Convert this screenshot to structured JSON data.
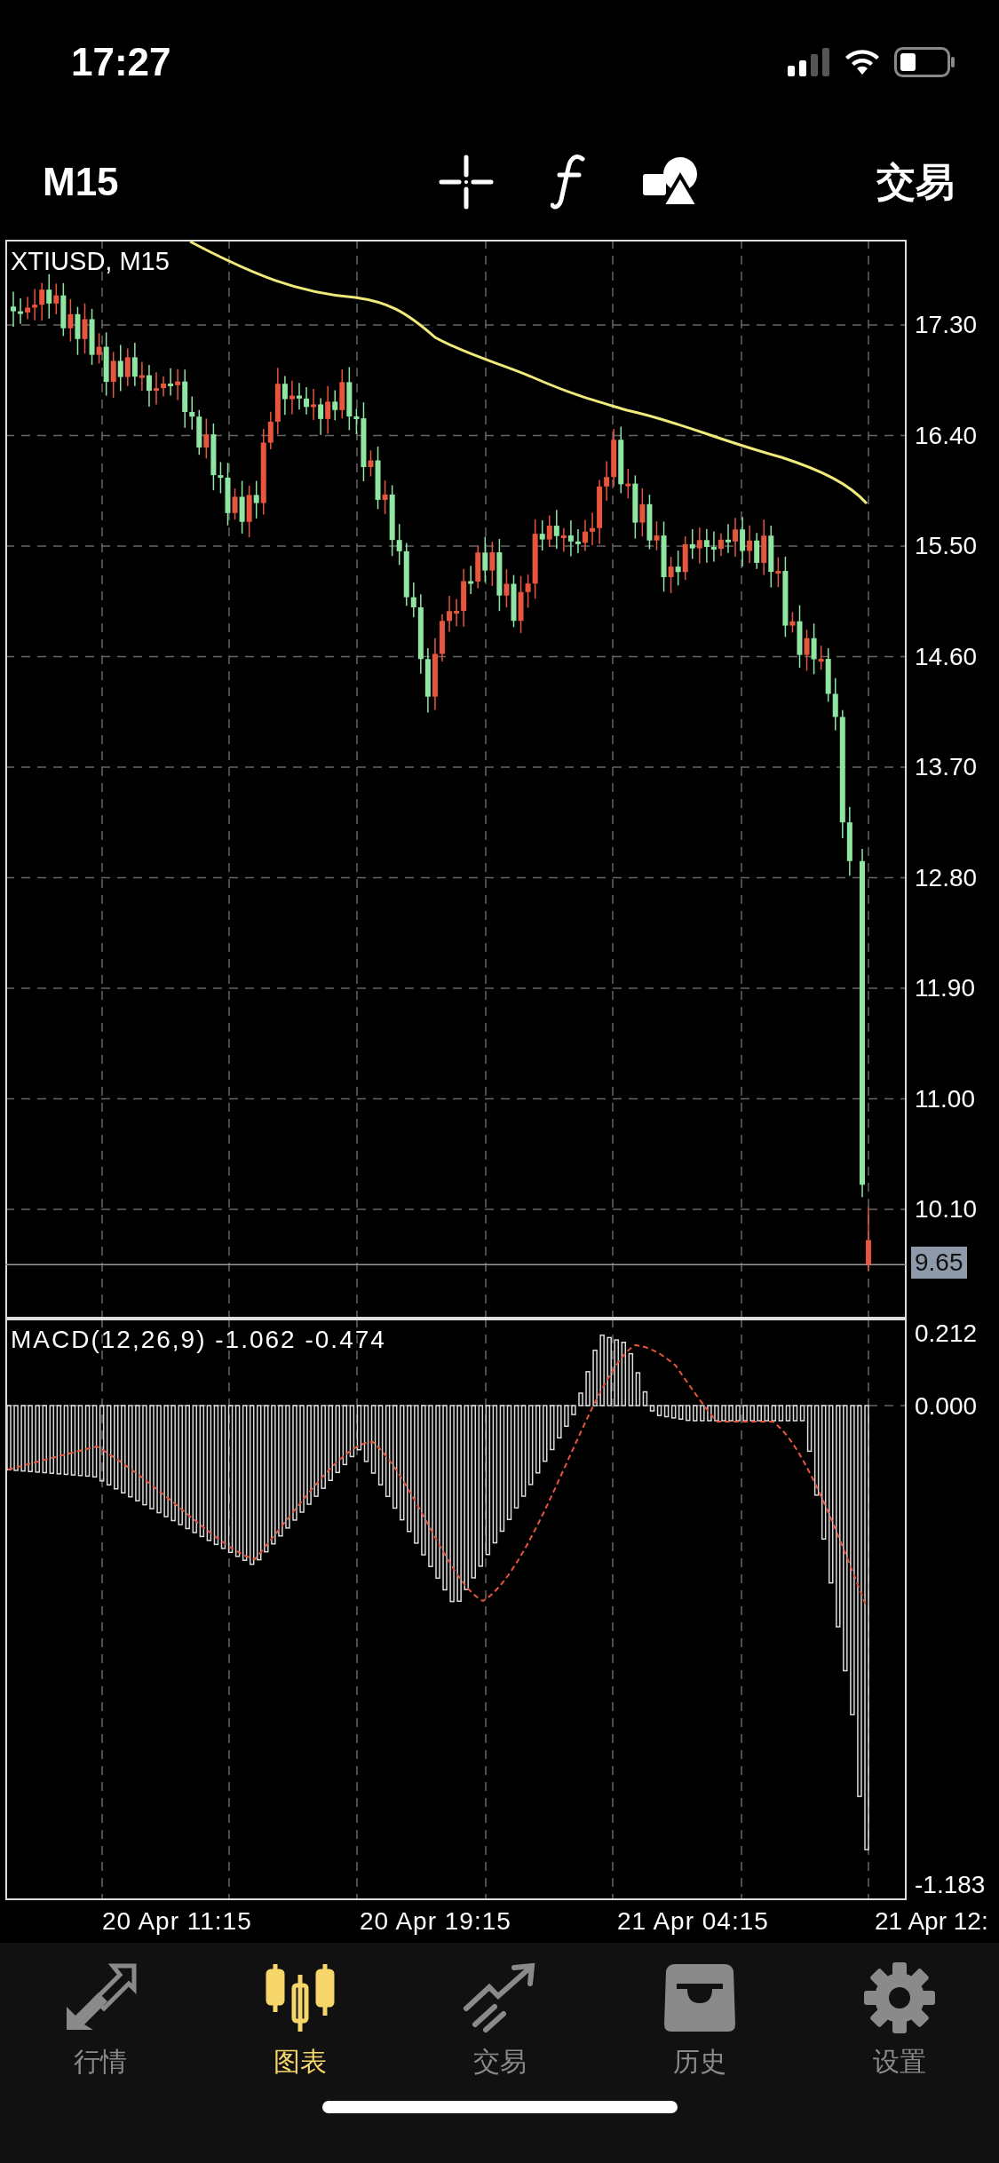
{
  "status_bar": {
    "time": "17:27"
  },
  "toolbar": {
    "timeframe": "M15",
    "trade_button": "交易"
  },
  "chart": {
    "symbol_label": "XTIUSD, M15",
    "price_ticks": [
      "17.30",
      "16.40",
      "15.50",
      "14.60",
      "13.70",
      "12.80",
      "11.90",
      "11.00",
      "10.10"
    ],
    "current_price": "9.65",
    "indicator_label": "MACD(12,26,9) -1.062 -0.474",
    "indicator_ticks": [
      "0.212",
      "0.000",
      "-1.183"
    ],
    "time_labels": [
      "20 Apr 11:15",
      "20 Apr 19:15",
      "21 Apr 04:15",
      "21 Apr 12:"
    ]
  },
  "tabs": [
    {
      "label": "行情",
      "selected": false
    },
    {
      "label": "图表",
      "selected": true
    },
    {
      "label": "交易",
      "selected": false
    },
    {
      "label": "历史",
      "selected": false
    },
    {
      "label": "设置",
      "selected": false
    }
  ]
}
